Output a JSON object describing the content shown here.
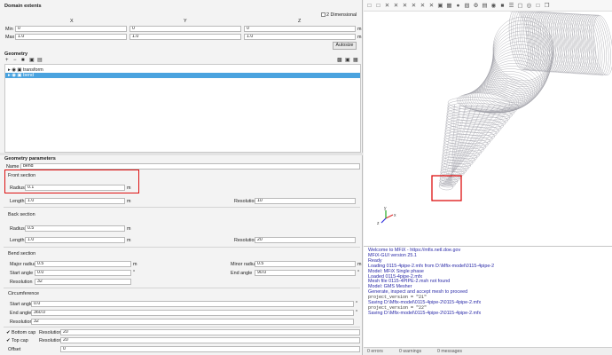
{
  "domain_extents": {
    "title": "Domain extents",
    "two_d_label": "2 Dimensional",
    "col_x": "X",
    "col_y": "Y",
    "col_z": "Z",
    "min_label": "Min",
    "max_label": "Max",
    "min": {
      "x": "0",
      "y": "0",
      "z": "0"
    },
    "max": {
      "x": "1.0",
      "y": "1.0",
      "z": "1.0"
    },
    "unit": "m",
    "autosize_label": "Autosize"
  },
  "geometry": {
    "title": "Geometry",
    "toolbar_left": [
      "+",
      "−",
      "■",
      "▣",
      "▤"
    ],
    "toolbar_right": [
      "▩",
      "▣",
      "▦"
    ],
    "items": [
      {
        "label": "transform",
        "selected": false
      },
      {
        "label": "bend",
        "selected": true
      }
    ]
  },
  "params": {
    "title": "Geometry parameters",
    "name_label": "Name",
    "name_value": "bend",
    "front": {
      "title": "Front section",
      "radius_label": "Radius",
      "radius_value": "0.1",
      "length_label": "Length",
      "length_value": "1.0",
      "resolution_label": "Resolution",
      "resolution_value": "10"
    },
    "back": {
      "title": "Back section",
      "radius_label": "Radius",
      "radius_value": "0.5",
      "length_label": "Length",
      "length_value": "1.0",
      "resolution_label": "Resolution",
      "resolution_value": "20"
    },
    "bend": {
      "title": "Bend section",
      "major_label": "Major radius",
      "major_value": "0.5",
      "minor_label": "Minor radius",
      "minor_value": "0.5",
      "start_label": "Start angle",
      "start_value": "0.0",
      "end_label": "End angle",
      "end_value": "90.0",
      "resolution_label": "Resolution",
      "resolution_value": "32"
    },
    "circ": {
      "title": "Circumference",
      "start_label": "Start angle",
      "start_value": "0.0",
      "end_label": "End angle",
      "end_value": "360.0",
      "resolution_label": "Resolution",
      "resolution_value": "32"
    },
    "bottom_cap_label": "Bottom cap",
    "bottom_res_label": "Resolution",
    "bottom_res_value": "20",
    "top_cap_label": "Top cap",
    "top_res_label": "Resolution",
    "top_res_value": "20",
    "offset_label": "Offset",
    "offset_value": "0",
    "unit_m": "m",
    "unit_deg": "°"
  },
  "console": {
    "lines": [
      {
        "text": "Welcome to MFiX - https://mfix.netl.doe.gov",
        "mono": false
      },
      {
        "text": "MFiX-GUI version 25.1",
        "mono": false
      },
      {
        "text": "Ready",
        "mono": false
      },
      {
        "text": "Loading 0115-4pipe-2.mfx from D:\\Mfix-model\\0115-4pipe-2",
        "mono": false
      },
      {
        "text": "Model: MFiX Single phase",
        "mono": false
      },
      {
        "text": "Loaded 0115-4pipe-2.mfx",
        "mono": false
      },
      {
        "text": "Mesh file 0115-4PIPE-2.msh not found",
        "mono": false
      },
      {
        "text": "Model: GMS Mesher",
        "mono": false
      },
      {
        "text": "Generate, inspect and accept mesh to proceed",
        "mono": false
      },
      {
        "text": "project_version = \"21\"",
        "mono": true
      },
      {
        "text": "Saving D:\\Mfix-model\\0115-4pipe-2\\0115-4pipe-2.mfx",
        "mono": false
      },
      {
        "text": "project_version = \"22\"",
        "mono": true
      },
      {
        "text": "Saving D:\\Mfix-model\\0115-4pipe-2\\0115-4pipe-2.mfx",
        "mono": false
      }
    ]
  },
  "status": {
    "errors": "0 errors",
    "warnings": "0 warnings",
    "messages": "0 messages"
  },
  "viewer_toolbar": [
    "□",
    "□",
    "✕",
    "✕",
    "✕",
    "✕",
    "✕",
    "✕",
    "▣",
    "▦",
    "●",
    "▧",
    "⚙",
    "▤",
    "◉",
    "■",
    "☰",
    "▢",
    "◎",
    "□",
    "❐"
  ],
  "axes": {
    "x": "x",
    "y": "y",
    "z": "z"
  },
  "colors": {
    "accent": "#4aa3df",
    "highlight": "#d11111",
    "console_text": "#2a2aa8"
  }
}
